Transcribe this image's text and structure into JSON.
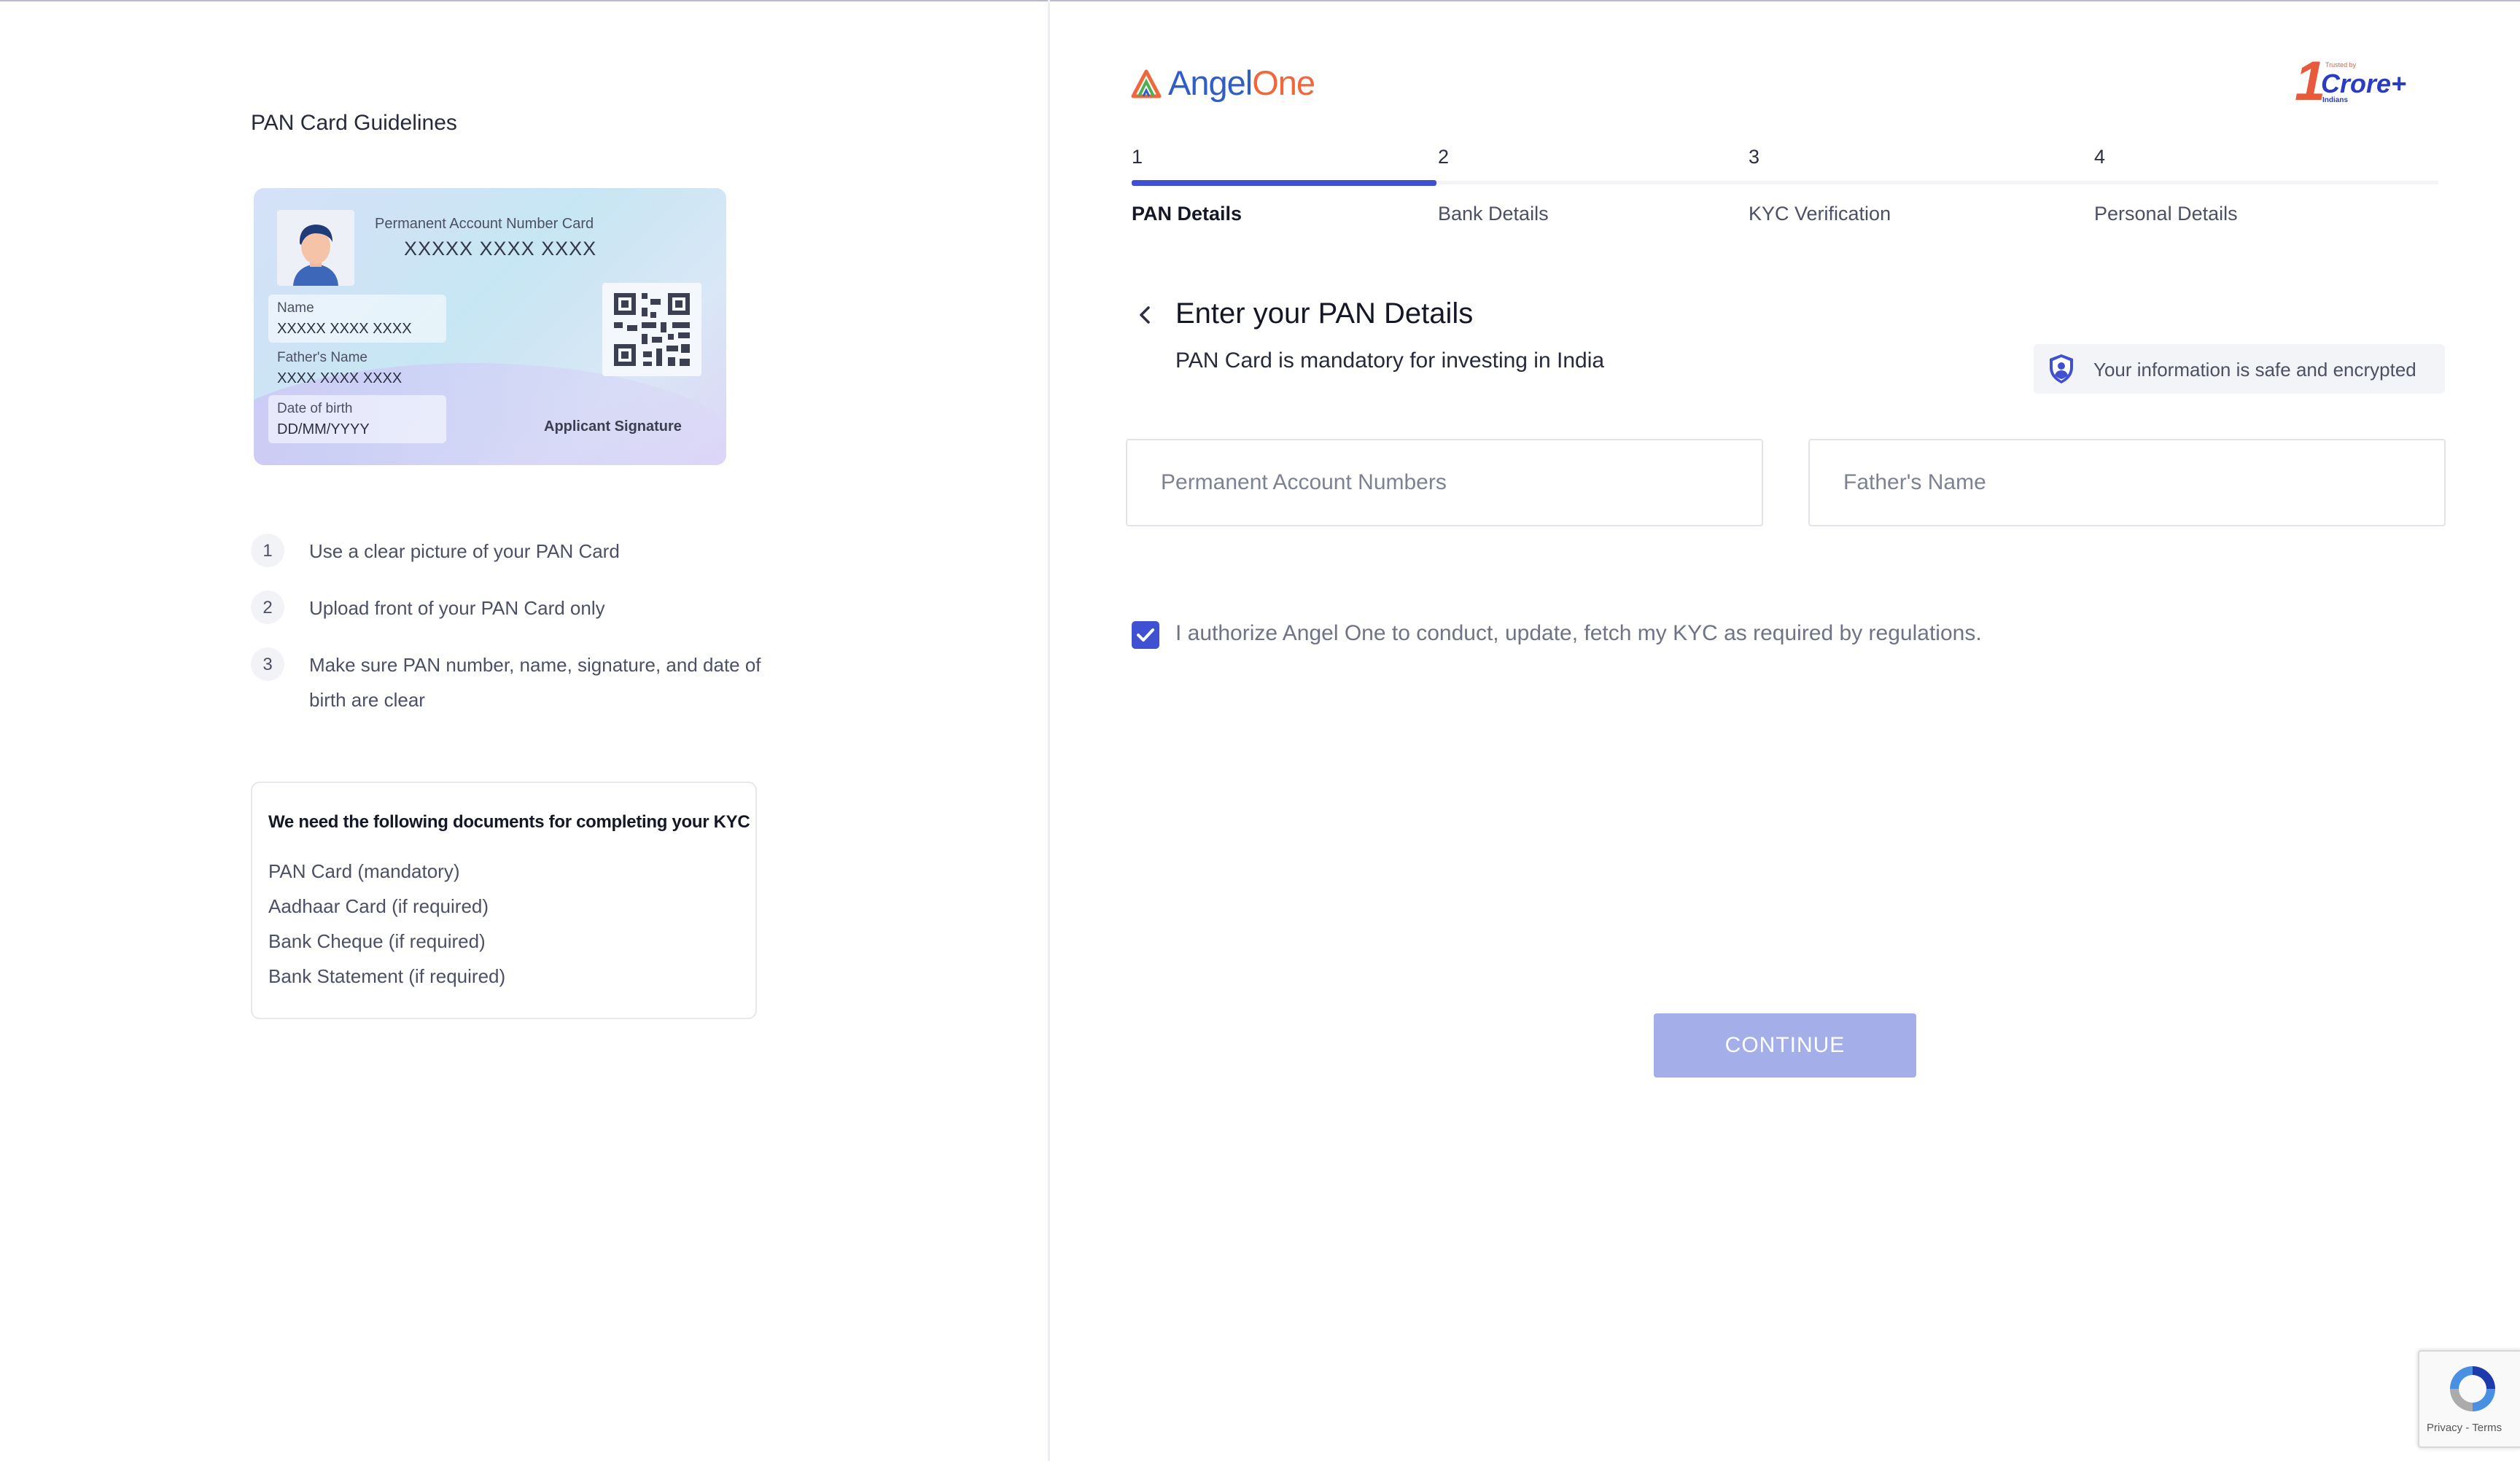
{
  "left": {
    "title": "PAN Card Guidelines",
    "card": {
      "heading": "Permanent Account Number Card",
      "number": "XXXXX XXXX XXXX",
      "name_label": "Name",
      "name_value": "XXXXX XXXX XXXX",
      "father_label": "Father's Name",
      "father_value": "XXXX XXXX XXXX",
      "dob_label": "Date of birth",
      "dob_value": "DD/MM/YYYY",
      "signature": "Applicant Signature"
    },
    "steps": [
      {
        "num": "1",
        "text": "Use a clear picture of your PAN Card"
      },
      {
        "num": "2",
        "text": "Upload front of your PAN Card only"
      },
      {
        "num": "3",
        "text": "Make sure PAN number, name, signature, and date of birth are clear"
      }
    ],
    "docs": {
      "heading": "We need the following documents for completing your KYC",
      "items": [
        "PAN Card (mandatory)",
        "Aadhaar Card (if required)",
        "Bank Cheque (if required)",
        "Bank Statement (if required)"
      ]
    }
  },
  "header": {
    "brand_part1": "Angel",
    "brand_part2": "One",
    "badge_number": "1",
    "badge_word": "Crore+",
    "badge_small": "Indians",
    "badge_tiny": "Trusted by"
  },
  "stepper": {
    "steps": [
      {
        "num": "1",
        "label": "PAN Details"
      },
      {
        "num": "2",
        "label": "Bank Details"
      },
      {
        "num": "3",
        "label": "KYC Verification"
      },
      {
        "num": "4",
        "label": "Personal Details"
      }
    ],
    "active_index": 0
  },
  "form": {
    "heading": "Enter your PAN Details",
    "subheading": "PAN Card is mandatory for investing in India",
    "safe_note": "Your information is safe and encrypted",
    "pan_placeholder": "Permanent Account Numbers",
    "father_placeholder": "Father's Name",
    "pan_value": "",
    "father_value": "",
    "consent_checked": true,
    "consent_text": "I authorize Angel One to conduct, update, fetch my KYC as required by regulations.",
    "continue_label": "CONTINUE"
  },
  "recaptcha": {
    "links": "Privacy - Terms"
  },
  "colors": {
    "accent": "#3f51d2",
    "button_disabled": "#a4aee9",
    "brand_blue": "#2f5ec7",
    "brand_orange": "#f0673b"
  },
  "icons": [
    "user-avatar-icon",
    "qr-code-icon",
    "chevron-left-icon",
    "shield-user-icon",
    "checkmark-icon",
    "recaptcha-icon",
    "angel-one-logo-icon"
  ]
}
